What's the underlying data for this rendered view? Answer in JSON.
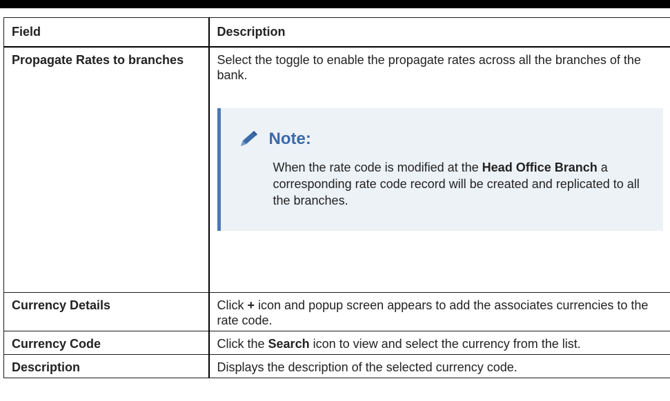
{
  "table": {
    "header": {
      "field": "Field",
      "description": "Description"
    },
    "rows": [
      {
        "field": "Propagate Rates to branches",
        "description": "Select the toggle to enable the propagate rates across all the branches of the bank."
      },
      {
        "field": "Currency Details",
        "desc_pre": "Click ",
        "desc_bold": "+",
        "desc_post": " icon and popup screen appears to add the associates currencies to the rate code."
      },
      {
        "field": "Currency Code",
        "desc_pre": "Click the ",
        "desc_bold": "Search",
        "desc_post": " icon to view and select the currency from the list."
      },
      {
        "field": "Description",
        "description": "Displays the description of the selected currency code."
      }
    ]
  },
  "note": {
    "title": "Note:",
    "icon": "pencil-icon",
    "text_pre": "When the rate code is modified at the ",
    "text_bold": "Head Office Branch",
    "text_post": " a corresponding rate code record will be created and replicated to all the branches.",
    "accent_color": "#4a78b5",
    "background_color": "#edf2f7"
  }
}
